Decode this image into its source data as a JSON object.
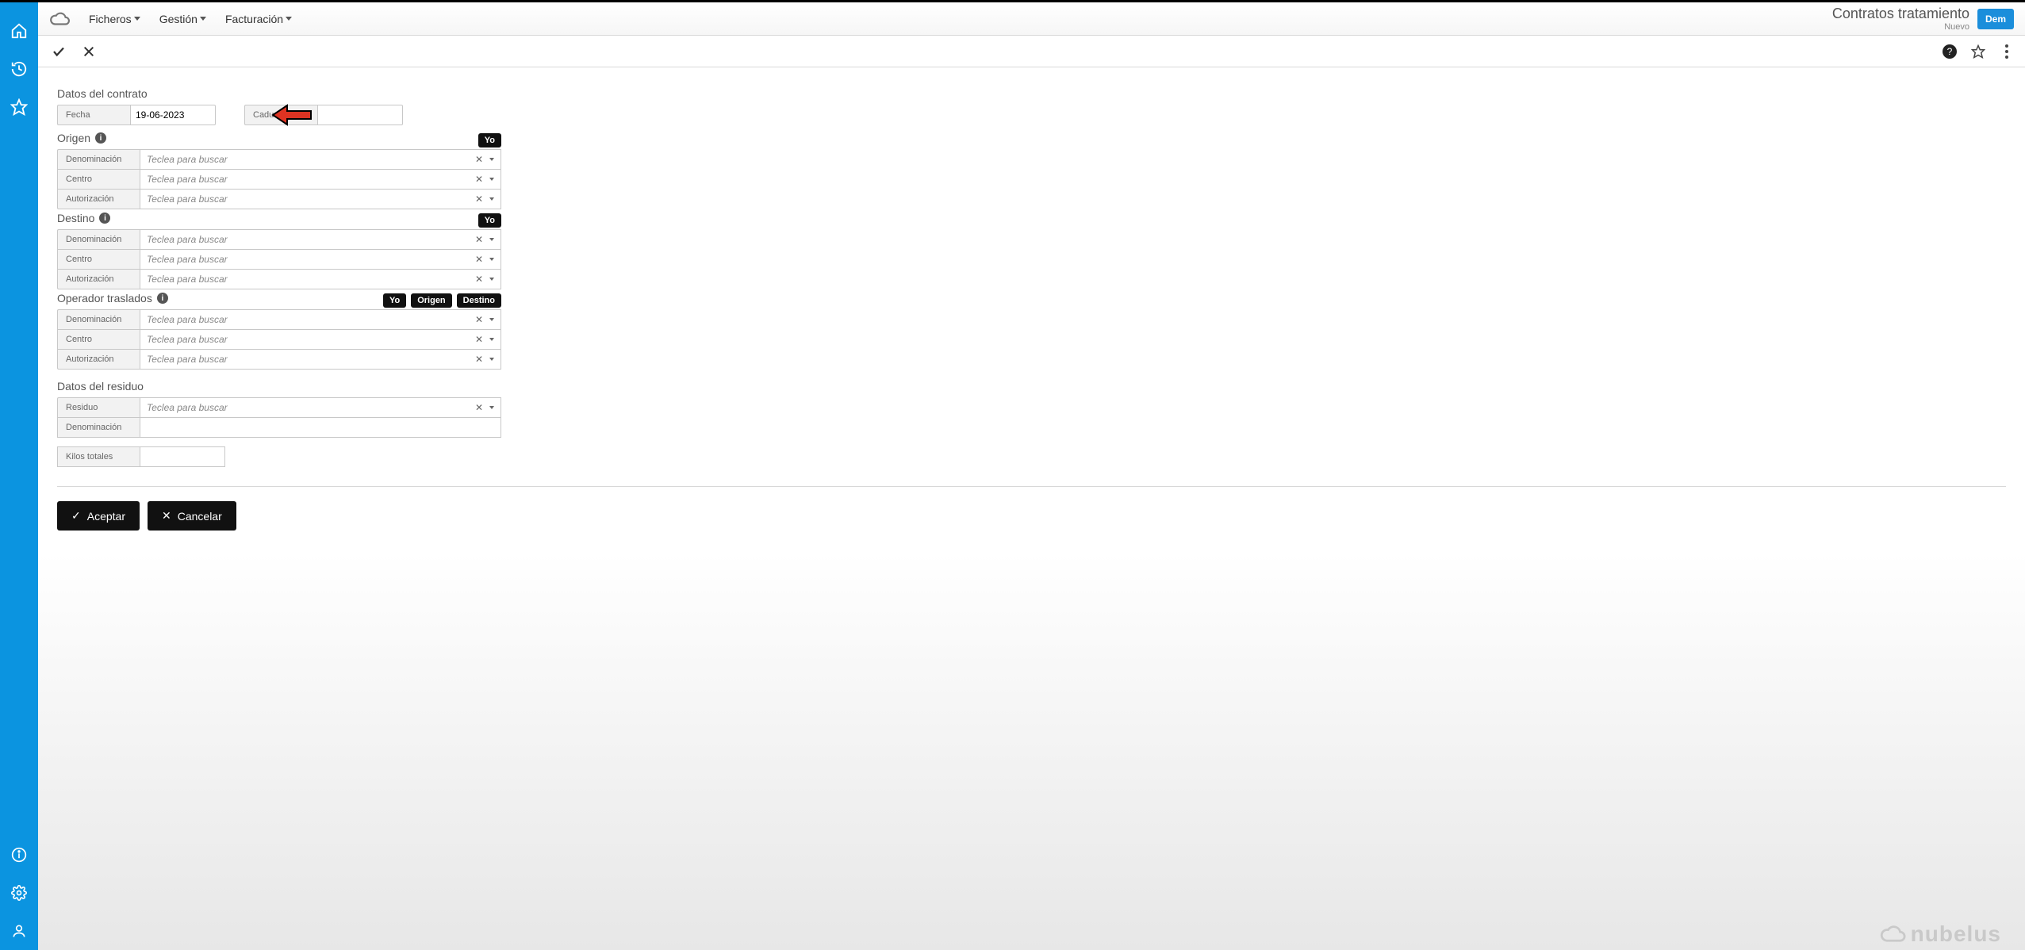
{
  "header": {
    "menus": {
      "ficheros": "Ficheros",
      "gestion": "Gestión",
      "facturacion": "Facturación"
    },
    "title": "Contratos tratamiento",
    "subtitle": "Nuevo",
    "dem_button": "Dem"
  },
  "sections": {
    "datos_contrato": {
      "title": "Datos del contrato",
      "fecha_label": "Fecha",
      "fecha_value": "19-06-2023",
      "caducidad_label": "Caducidad",
      "caducidad_value": ""
    },
    "origen": {
      "title": "Origen",
      "yo_pill": "Yo",
      "rows": {
        "denominacion": {
          "label": "Denominación",
          "placeholder": "Teclea para buscar"
        },
        "centro": {
          "label": "Centro",
          "placeholder": "Teclea para buscar"
        },
        "autorizacion": {
          "label": "Autorización",
          "placeholder": "Teclea para buscar"
        }
      }
    },
    "destino": {
      "title": "Destino",
      "yo_pill": "Yo",
      "rows": {
        "denominacion": {
          "label": "Denominación",
          "placeholder": "Teclea para buscar"
        },
        "centro": {
          "label": "Centro",
          "placeholder": "Teclea para buscar"
        },
        "autorizacion": {
          "label": "Autorización",
          "placeholder": "Teclea para buscar"
        }
      }
    },
    "operador": {
      "title": "Operador traslados",
      "pills": {
        "yo": "Yo",
        "origen": "Origen",
        "destino": "Destino"
      },
      "rows": {
        "denominacion": {
          "label": "Denominación",
          "placeholder": "Teclea para buscar"
        },
        "centro": {
          "label": "Centro",
          "placeholder": "Teclea para buscar"
        },
        "autorizacion": {
          "label": "Autorización",
          "placeholder": "Teclea para buscar"
        }
      }
    },
    "datos_residuo": {
      "title": "Datos del residuo",
      "residuo": {
        "label": "Residuo",
        "placeholder": "Teclea para buscar"
      },
      "denominacion_label": "Denominación",
      "denominacion_value": "",
      "kilos_label": "Kilos totales",
      "kilos_value": ""
    }
  },
  "buttons": {
    "aceptar": "Aceptar",
    "cancelar": "Cancelar"
  },
  "watermark": "nubelus"
}
